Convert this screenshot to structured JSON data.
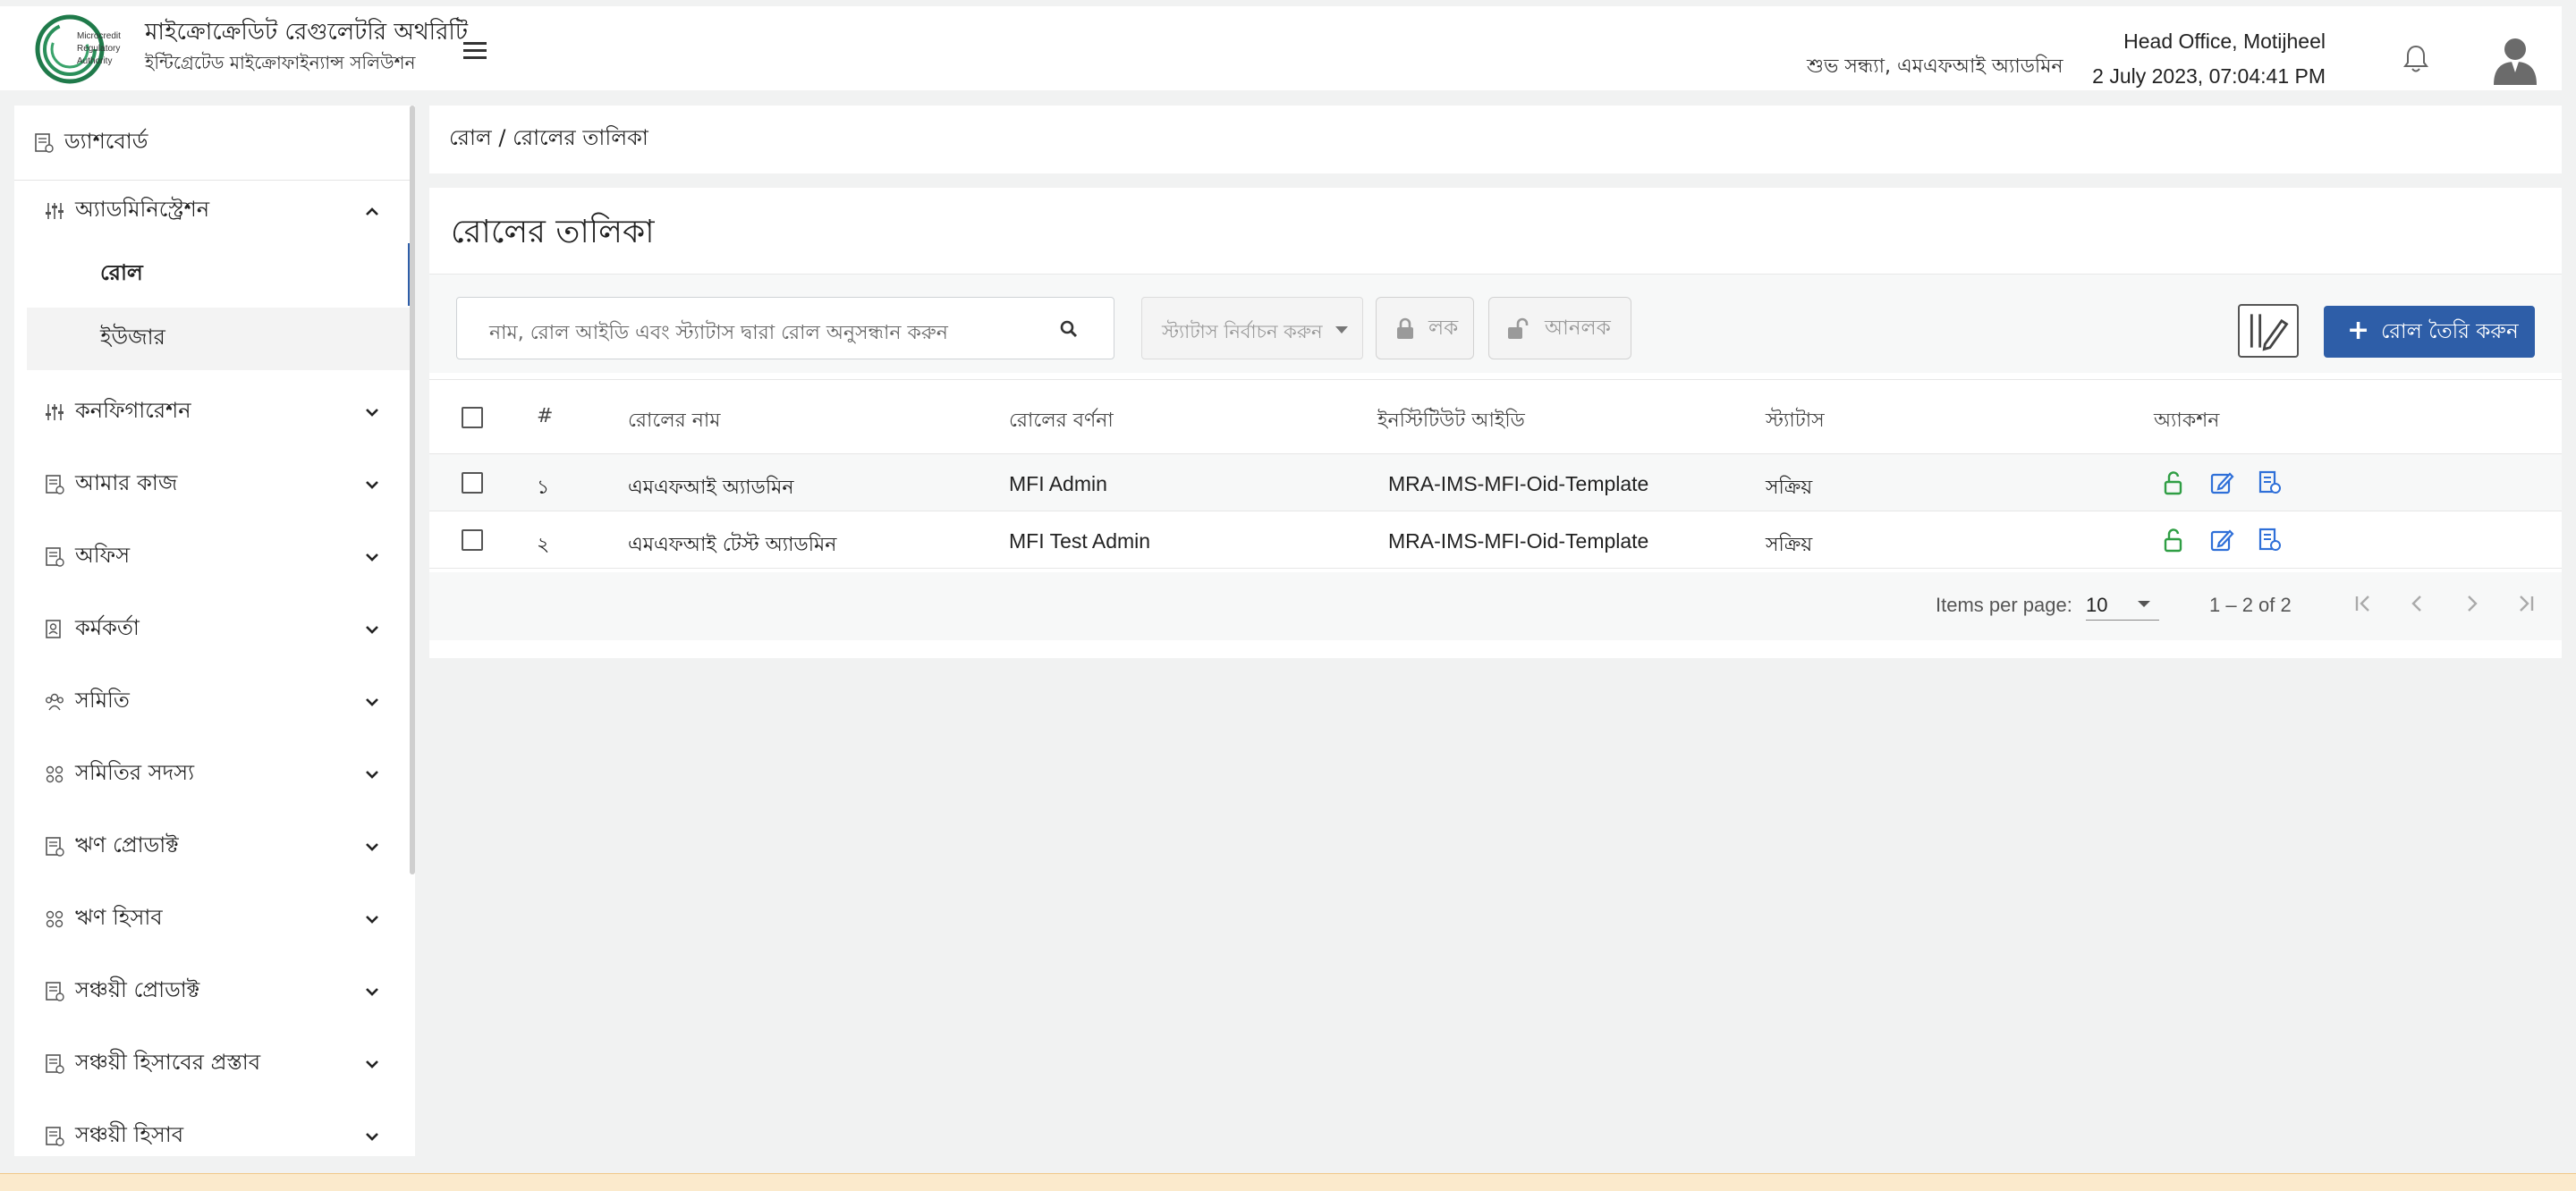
{
  "header": {
    "logo_text": "Microcredit Regulatory Authority",
    "title": "মাইক্রোক্রেডিট রেগুলেটরি অথরিটি",
    "subtitle": "ইন্টিগ্রেটেড মাইক্রোফাইন্যান্স সলিউশন",
    "greeting": "শুভ সন্ধ্যা, এমএফআই অ্যাডমিন",
    "office": "Head Office, Motijheel",
    "datetime": "2 July 2023, 07:04:41 PM"
  },
  "sidebar": {
    "dashboard": "ড্যাশবোর্ড",
    "items": [
      {
        "label": "অ্যাডমিনিস্ট্রেশন",
        "icon": "sliders-icon",
        "expanded": true
      },
      {
        "label": "কনফিগারেশন",
        "icon": "sliders-icon"
      },
      {
        "label": "আমার কাজ",
        "icon": "document-icon"
      },
      {
        "label": "অফিস",
        "icon": "document-icon"
      },
      {
        "label": "কর্মকর্তা",
        "icon": "person-document-icon"
      },
      {
        "label": "সমিতি",
        "icon": "group-icon"
      },
      {
        "label": "সমিতির সদস্য",
        "icon": "members-icon"
      },
      {
        "label": "ঋণ প্রোডাক্ট",
        "icon": "document-icon"
      },
      {
        "label": "ঋণ হিসাব",
        "icon": "members-icon"
      },
      {
        "label": "সঞ্চয়ী প্রোডাক্ট",
        "icon": "document-icon"
      },
      {
        "label": "সঞ্চয়ী হিসাবের প্রস্তাব",
        "icon": "document-icon"
      },
      {
        "label": "সঞ্চয়ী হিসাব",
        "icon": "document-icon"
      }
    ],
    "sub_items": [
      {
        "label": "রোল",
        "active": true
      },
      {
        "label": "ইউজার",
        "active": false
      }
    ]
  },
  "breadcrumb": "রোল / রোলের তালিকা",
  "page_title": "রোলের তালিকা",
  "toolbar": {
    "search_placeholder": "নাম, রোল আইডি এবং স্ট্যাটাস দ্বারা রোল অনুসন্ধান করুন",
    "status_placeholder": "স্ট্যাটাস নির্বাচন করুন",
    "lock_label": "লক",
    "unlock_label": "আনলক",
    "create_label": "রোল তৈরি করুন",
    "create_plus": "+"
  },
  "table": {
    "headers": {
      "index": "#",
      "name": "রোলের নাম",
      "description": "রোলের বর্ণনা",
      "institute_id": "ইনস্টিটিউট আইডি",
      "status": "স্ট্যাটাস",
      "action": "অ্যাকশন"
    },
    "rows": [
      {
        "index": "১",
        "name": "এমএফআই অ্যাডমিন",
        "description": "MFI Admin",
        "institute_id": "MRA-IMS-MFI-Oid-Template",
        "status": "সক্রিয়"
      },
      {
        "index": "২",
        "name": "এমএফআই টেস্ট অ্যাডমিন",
        "description": "MFI Test Admin",
        "institute_id": "MRA-IMS-MFI-Oid-Template",
        "status": "সক্রিয়"
      }
    ]
  },
  "paginator": {
    "items_per_page_label": "Items per page:",
    "items_per_page": "10",
    "range": "1 – 2 of 2"
  },
  "colors": {
    "primary": "#2e5ea8",
    "unlock_green": "#2f9e44",
    "edit_blue": "#2e6fd8"
  }
}
